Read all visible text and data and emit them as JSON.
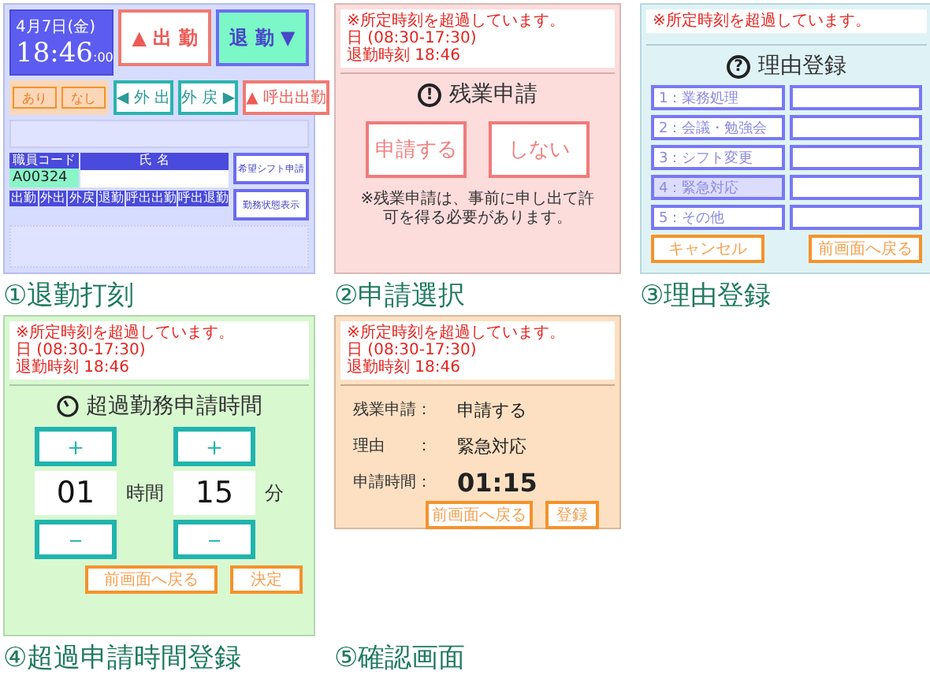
{
  "punch_screen": {
    "date": "4月7日(金)",
    "time": "18:46",
    "seconds": ":00",
    "choice_buttons": [
      "あり",
      "なし"
    ],
    "buttons": [
      {
        "label": "▲ 出 勤",
        "kind": "in"
      },
      {
        "label": "退 勤 ▼",
        "kind": "out"
      }
    ],
    "sub_buttons": [
      {
        "label": "◀ 外 出",
        "kind": "go"
      },
      {
        "label": "外 戻 ▶",
        "kind": "go"
      },
      {
        "label": "▲ 呼出出勤",
        "kind": "call"
      }
    ],
    "employee_code_label": "職員コード",
    "employee_code": "A00324",
    "name_label": "氏 名",
    "table_columns": [
      "出勤",
      "外出",
      "外戻",
      "退勤",
      "呼出出勤",
      "呼出退勤"
    ],
    "side_buttons": [
      "希望シフト申請",
      "勤務状態表示"
    ],
    "caption": "①退勤打刻"
  },
  "request_screen": {
    "alert": [
      "※所定時刻を超過しています。",
      "日 (08:30-17:30)",
      "退勤時刻 18:46"
    ],
    "icon_text": "!",
    "title": "残業申請",
    "buttons": [
      "申請する",
      "しない"
    ],
    "note": "※残業申請は、事前に申し出て許可を得る必要があります。",
    "caption": "②申請選択"
  },
  "reason_screen": {
    "alert": [
      "※所定時刻を超過しています。"
    ],
    "icon_text": "?",
    "title": "理由登録",
    "reasons": [
      {
        "label": "1：業務処理",
        "selected": false
      },
      {
        "label": "2：会議・勉強会",
        "selected": false
      },
      {
        "label": "3：シフト変更",
        "selected": false
      },
      {
        "label": "4：緊急対応",
        "selected": true
      },
      {
        "label": "5：その他",
        "selected": false
      }
    ],
    "buttons": [
      "キャンセル",
      "前画面へ戻る"
    ],
    "caption": "③理由登録"
  },
  "time_screen": {
    "alert": [
      "※所定時刻を超過しています。",
      "日 (08:30-17:30)",
      "退勤時刻 18:46"
    ],
    "title": "超過勤務申請時間",
    "plus": "＋",
    "minus": "－",
    "hours": "01",
    "hours_unit": "時間",
    "minutes": "15",
    "minutes_unit": "分",
    "buttons": [
      "前画面へ戻る",
      "決定"
    ],
    "caption": "④超過申請時間登録"
  },
  "confirm_screen": {
    "alert": [
      "※所定時刻を超過しています。",
      "日 (08:30-17:30)",
      "退勤時刻 18:46"
    ],
    "rows": [
      {
        "label": "残業申請：",
        "value": "申請する",
        "kind": "text"
      },
      {
        "label": "理由　　：",
        "value": "緊急対応",
        "kind": "text"
      },
      {
        "label": "申請時間：",
        "value": "01:15",
        "kind": "big"
      }
    ],
    "buttons": [
      "前画面へ戻る",
      "登録"
    ],
    "caption": "⑤確認画面"
  }
}
